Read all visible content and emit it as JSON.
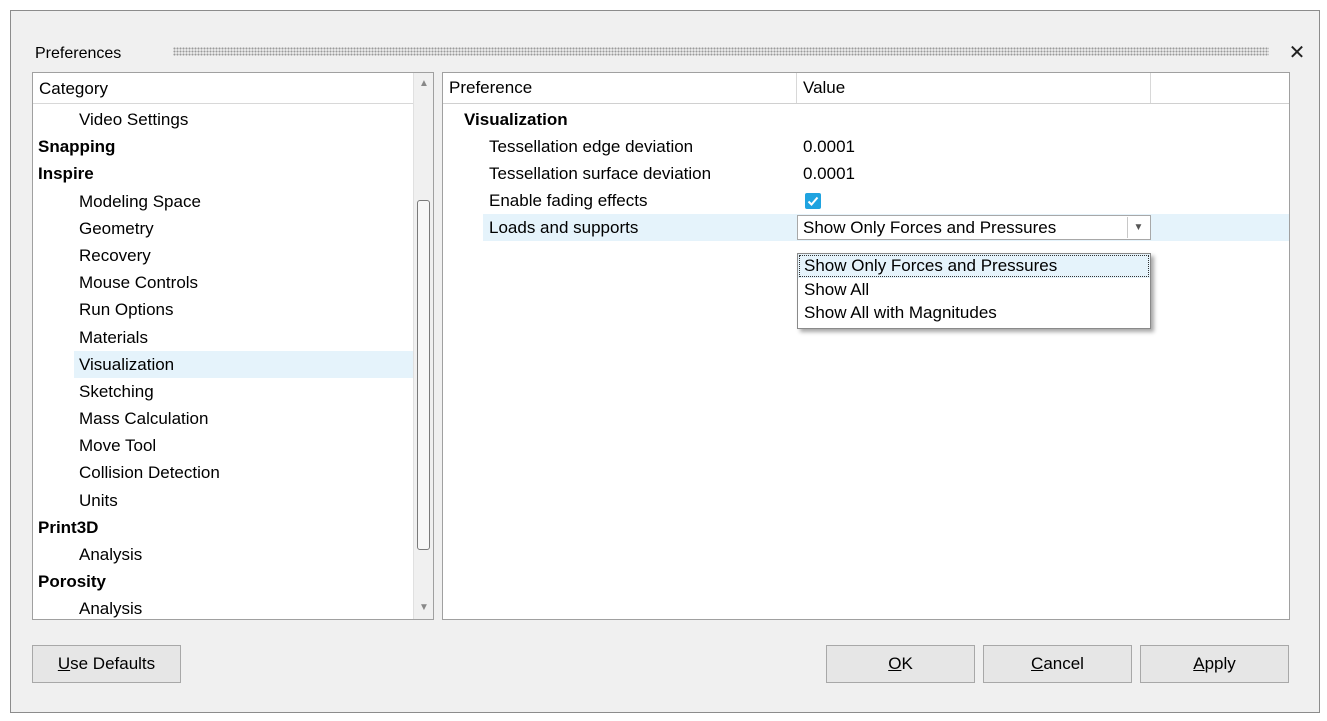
{
  "dialog": {
    "title": "Preferences",
    "close_glyph": "✕"
  },
  "category_panel": {
    "header": "Category",
    "items": [
      {
        "label": "Video Settings",
        "level": 1
      },
      {
        "label": "Snapping",
        "level": 0
      },
      {
        "label": "Inspire",
        "level": 0
      },
      {
        "label": "Modeling Space",
        "level": 1
      },
      {
        "label": "Geometry",
        "level": 1
      },
      {
        "label": "Recovery",
        "level": 1
      },
      {
        "label": "Mouse Controls",
        "level": 1
      },
      {
        "label": "Run Options",
        "level": 1
      },
      {
        "label": "Materials",
        "level": 1
      },
      {
        "label": "Visualization",
        "level": 1,
        "selected": true
      },
      {
        "label": "Sketching",
        "level": 1
      },
      {
        "label": "Mass Calculation",
        "level": 1
      },
      {
        "label": "Move Tool",
        "level": 1
      },
      {
        "label": "Collision Detection",
        "level": 1
      },
      {
        "label": "Units",
        "level": 1
      },
      {
        "label": "Print3D",
        "level": 0
      },
      {
        "label": "Analysis",
        "level": 1
      },
      {
        "label": "Porosity",
        "level": 0
      },
      {
        "label": "Analysis",
        "level": 1
      }
    ]
  },
  "preference_panel": {
    "col_preference": "Preference",
    "col_value": "Value",
    "group": "Visualization",
    "rows": [
      {
        "name": "Tessellation edge deviation",
        "value": "0.0001"
      },
      {
        "name": "Tessellation surface deviation",
        "value": "0.0001"
      },
      {
        "name": "Enable fading effects",
        "checked": true
      },
      {
        "name": "Loads and supports",
        "value": "Show Only Forces and Pressures"
      }
    ],
    "dropdown_options": [
      "Show Only Forces and Pressures",
      "Show All",
      "Show All with Magnitudes"
    ]
  },
  "buttons": {
    "use_defaults_first": "U",
    "use_defaults_rest": "se Defaults",
    "ok_first": "O",
    "ok_rest": "K",
    "cancel_first": "C",
    "cancel_rest": "ancel",
    "apply_first": "A",
    "apply_rest": "pply"
  },
  "colors": {
    "selection": "#e5f3fb",
    "checkbox": "#1fa3e0"
  }
}
